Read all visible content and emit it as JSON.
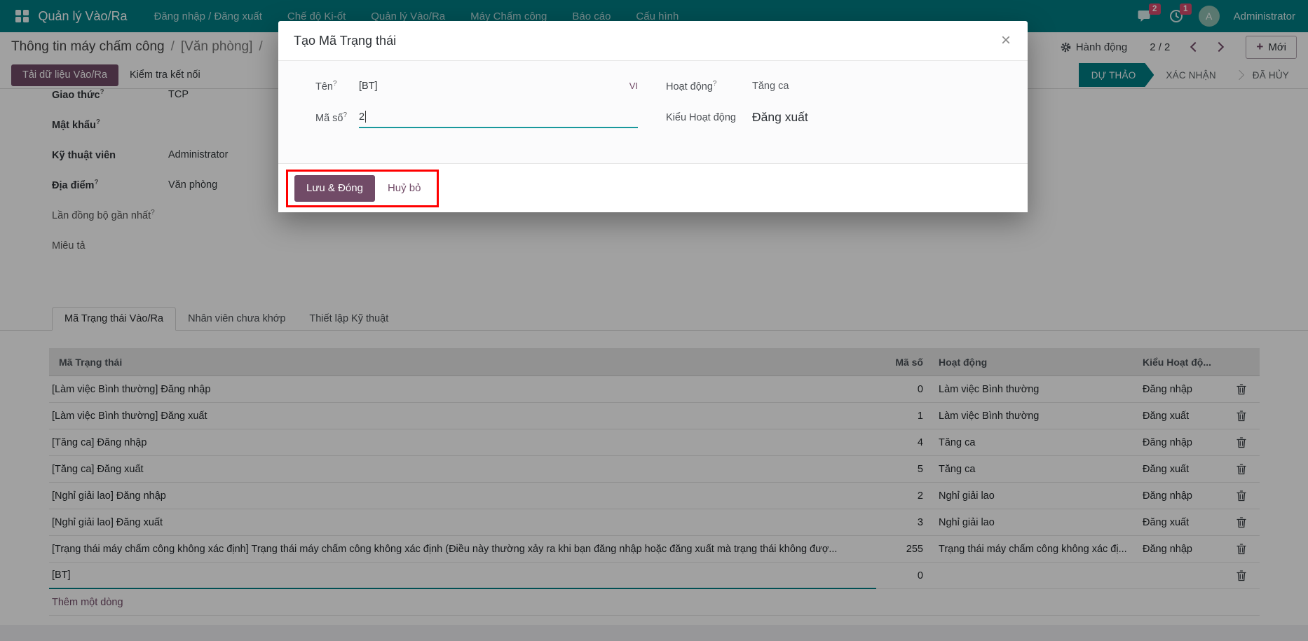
{
  "colors": {
    "accent": "#714B67",
    "teal": "#017e84",
    "badge": "#d84b6e",
    "highlight": "#ff0000"
  },
  "icons": {
    "apps": "apps-grid-icon",
    "messages": "chat-bubble-icon",
    "activities": "clock-icon",
    "actions": "gear-icon",
    "delete": "trash-icon",
    "close": "close-icon"
  },
  "nav": {
    "brand": "Quản lý Vào/Ra",
    "items": [
      "Đăng nhập / Đăng xuất",
      "Chế độ Ki-ốt",
      "Quản lý Vào/Ra",
      "Máy Chấm công",
      "Báo cáo",
      "Cấu hình"
    ],
    "messages_badge": "2",
    "activities_badge": "1",
    "avatar_initial": "A",
    "user": "Administrator"
  },
  "breadcrumb": {
    "parent": "Thông tin máy chấm công",
    "sep": "/",
    "current": "[Văn phòng]",
    "trailing": "/"
  },
  "control": {
    "actions": "Hành động",
    "pager": "2 / 2",
    "new_plus": "+",
    "new_label": "Mới"
  },
  "page_buttons": {
    "load": "Tải dữ liệu Vào/Ra",
    "test": "Kiểm tra kết nối"
  },
  "statusbar": [
    {
      "label": "DỰ THẢO",
      "active": true
    },
    {
      "label": "XÁC NHẬN",
      "active": false
    },
    {
      "label": "ĐÃ HỦY",
      "active": false
    }
  ],
  "form": {
    "fields": [
      {
        "label": "Giao thức",
        "help": "?",
        "value": "TCP",
        "bold": true
      },
      {
        "label": "Mật khẩu",
        "help": "?",
        "value": "",
        "bold": true
      },
      {
        "label": "Kỹ thuật viên",
        "help": "",
        "value": "Administrator",
        "bold": true
      },
      {
        "label": "Địa điểm",
        "help": "?",
        "value": "Văn phòng",
        "bold": true
      },
      {
        "label": "Lần đồng bộ gần nhất",
        "help": "?",
        "value": "",
        "bold": false
      },
      {
        "label": "Miêu tả",
        "help": "",
        "value": "",
        "bold": false
      }
    ]
  },
  "tabs": [
    {
      "label": "Mã Trạng thái Vào/Ra",
      "active": true
    },
    {
      "label": "Nhân viên chưa khớp",
      "active": false
    },
    {
      "label": "Thiết lập Kỹ thuật",
      "active": false
    }
  ],
  "table": {
    "headers": {
      "name": "Mã Trạng thái",
      "code": "Mã số",
      "activity": "Hoạt động",
      "type": "Kiểu Hoạt độ..."
    },
    "rows": [
      {
        "name": "[Làm việc Bình thường] Đăng nhập",
        "code": "0",
        "activity": "Làm việc Bình thường",
        "type": "Đăng nhập",
        "editing": false
      },
      {
        "name": "[Làm việc Bình thường] Đăng xuất",
        "code": "1",
        "activity": "Làm việc Bình thường",
        "type": "Đăng xuất",
        "editing": false
      },
      {
        "name": "[Tăng ca] Đăng nhập",
        "code": "4",
        "activity": "Tăng ca",
        "type": "Đăng nhập",
        "editing": false
      },
      {
        "name": "[Tăng ca] Đăng xuất",
        "code": "5",
        "activity": "Tăng ca",
        "type": "Đăng xuất",
        "editing": false
      },
      {
        "name": "[Nghỉ giải lao] Đăng nhập",
        "code": "2",
        "activity": "Nghỉ giải lao",
        "type": "Đăng nhập",
        "editing": false
      },
      {
        "name": "[Nghỉ giải lao] Đăng xuất",
        "code": "3",
        "activity": "Nghỉ giải lao",
        "type": "Đăng xuất",
        "editing": false
      },
      {
        "name": "[Trạng thái máy chấm công không xác định] Trạng thái máy chấm công không xác định (Điều này thường xảy ra khi bạn đăng nhập hoặc đăng xuất mà trạng thái không đượ...",
        "code": "255",
        "activity": "Trạng thái máy chấm công không xác đị...",
        "type": "Đăng nhập",
        "editing": false
      },
      {
        "name": "[BT]",
        "code": "0",
        "activity": "",
        "type": "",
        "editing": true
      }
    ],
    "add_line": "Thêm một dòng"
  },
  "modal": {
    "title": "Tạo Mã Trạng thái",
    "close_glyph": "×",
    "fields": {
      "name_label": "Tên",
      "name_help": "?",
      "name_value": "[BT]",
      "name_lang": "VI",
      "code_label": "Mã số",
      "code_help": "?",
      "code_value": "2",
      "activity_label": "Hoạt động",
      "activity_help": "?",
      "activity_value": "Tăng ca",
      "type_label": "Kiểu Hoạt động",
      "type_value": "Đăng xuất"
    },
    "footer": {
      "save": "Lưu & Đóng",
      "discard": "Huỷ bỏ"
    }
  }
}
